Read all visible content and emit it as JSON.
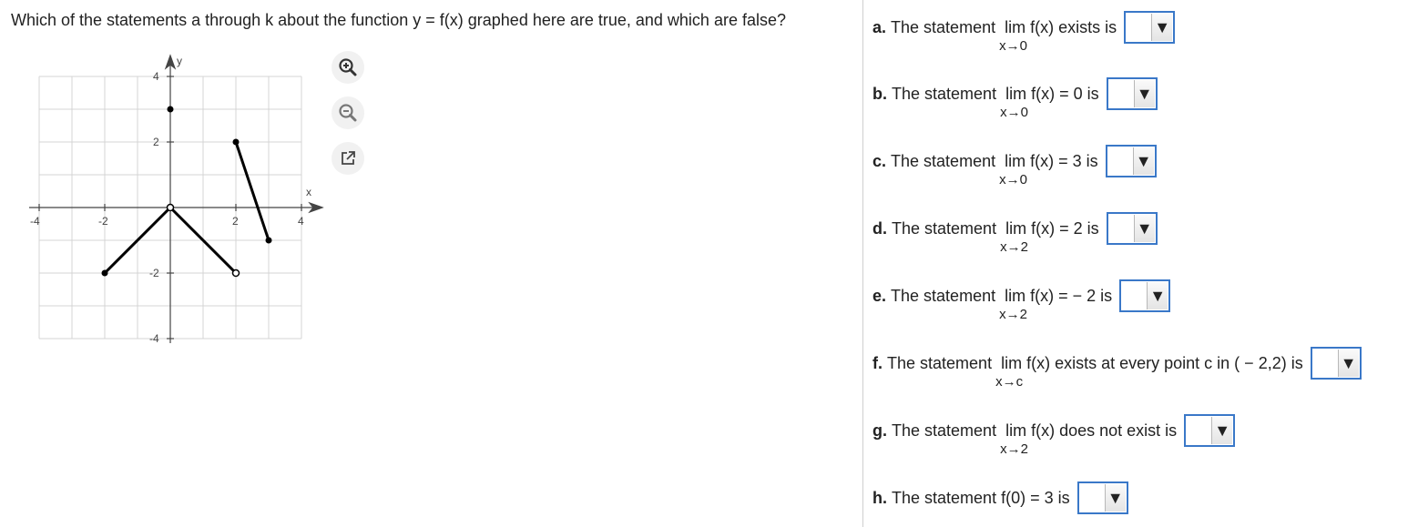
{
  "question": "Which of the statements a through k about the function y = f(x) graphed here are true, and which are false?",
  "graph": {
    "y_axis_label": "y",
    "x_axis_label": "x",
    "x_ticks": [
      "-4",
      "-2",
      "2",
      "4"
    ],
    "y_ticks": [
      "4",
      "2",
      "-2",
      "-4"
    ]
  },
  "toolbar": {
    "zoom_in": "zoom-in-icon",
    "zoom_out": "zoom-out-icon",
    "popout": "external-link-icon"
  },
  "statements": [
    {
      "letter": "a.",
      "pre": "The statement",
      "lim": "lim",
      "expr": "f(x) exists is",
      "sub": "x→0",
      "value": ""
    },
    {
      "letter": "b.",
      "pre": "The statement",
      "lim": "lim",
      "expr": "f(x) = 0 is",
      "sub": "x→0",
      "value": ""
    },
    {
      "letter": "c.",
      "pre": "The statement",
      "lim": "lim",
      "expr": "f(x) = 3 is",
      "sub": "x→0",
      "value": ""
    },
    {
      "letter": "d.",
      "pre": "The statement",
      "lim": "lim",
      "expr": "f(x) = 2 is",
      "sub": "x→2",
      "value": ""
    },
    {
      "letter": "e.",
      "pre": "The statement",
      "lim": "lim",
      "expr": "f(x) = − 2 is",
      "sub": "x→2",
      "value": ""
    },
    {
      "letter": "f.",
      "pre": "The statement",
      "lim": "lim",
      "expr": "f(x) exists at every point c in ( − 2,2) is",
      "sub": "x→c",
      "value": ""
    },
    {
      "letter": "g.",
      "pre": "The statement",
      "lim": "lim",
      "expr": "f(x) does not exist is",
      "sub": "x→2",
      "value": ""
    },
    {
      "letter": "h.",
      "pre": "The statement f(0) = 3 is",
      "lim": "",
      "expr": "",
      "sub": "",
      "value": ""
    }
  ]
}
